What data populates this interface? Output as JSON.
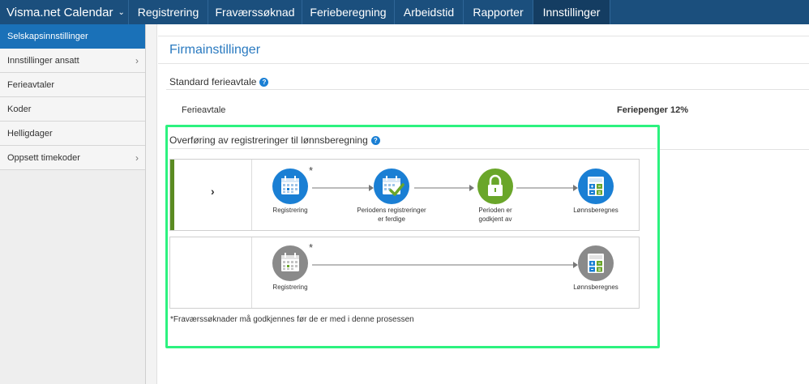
{
  "brand": {
    "title": "Visma.net Calendar"
  },
  "nav": {
    "tabs": [
      "Registrering",
      "Fraværssøknad",
      "Ferieberegning",
      "Arbeidstid",
      "Rapporter",
      "Innstillinger"
    ],
    "active": "Innstillinger"
  },
  "sidebar": {
    "items": [
      {
        "label": "Selskapsinnstillinger",
        "active": true,
        "has_children": false
      },
      {
        "label": "Innstillinger ansatt",
        "active": false,
        "has_children": true
      },
      {
        "label": "Ferieavtaler",
        "active": false,
        "has_children": false
      },
      {
        "label": "Koder",
        "active": false,
        "has_children": false
      },
      {
        "label": "Helligdager",
        "active": false,
        "has_children": false
      },
      {
        "label": "Oppsett timekoder",
        "active": false,
        "has_children": true
      }
    ]
  },
  "main": {
    "title": "Firmainstillinger",
    "standard_section": {
      "title": "Standard ferieavtale",
      "row_label": "Ferieavtale",
      "row_value": "Feriepenger 12%"
    },
    "transfer_section": {
      "title": "Overføring av registreringer til lønnsberegning",
      "flow1": {
        "steps": [
          "Registrering",
          "Periodens registreringer\ner ferdige",
          "Perioden er\ngodkjent av",
          "Lønnsberegnes"
        ]
      },
      "flow2": {
        "steps": [
          "Registrering",
          "Lønnsberegnes"
        ]
      },
      "footnote": "*Fraværssøknader må godkjennes før de er med i denne prosessen"
    }
  },
  "colors": {
    "nav_bg": "#1b4f7d",
    "sidebar_active": "#1a71b8",
    "node_blue": "#1a7fd4",
    "node_green": "#6aa62a",
    "node_gray": "#8a8a8a",
    "flow_bar": "#5a8b22",
    "highlight": "#2cf27f"
  }
}
